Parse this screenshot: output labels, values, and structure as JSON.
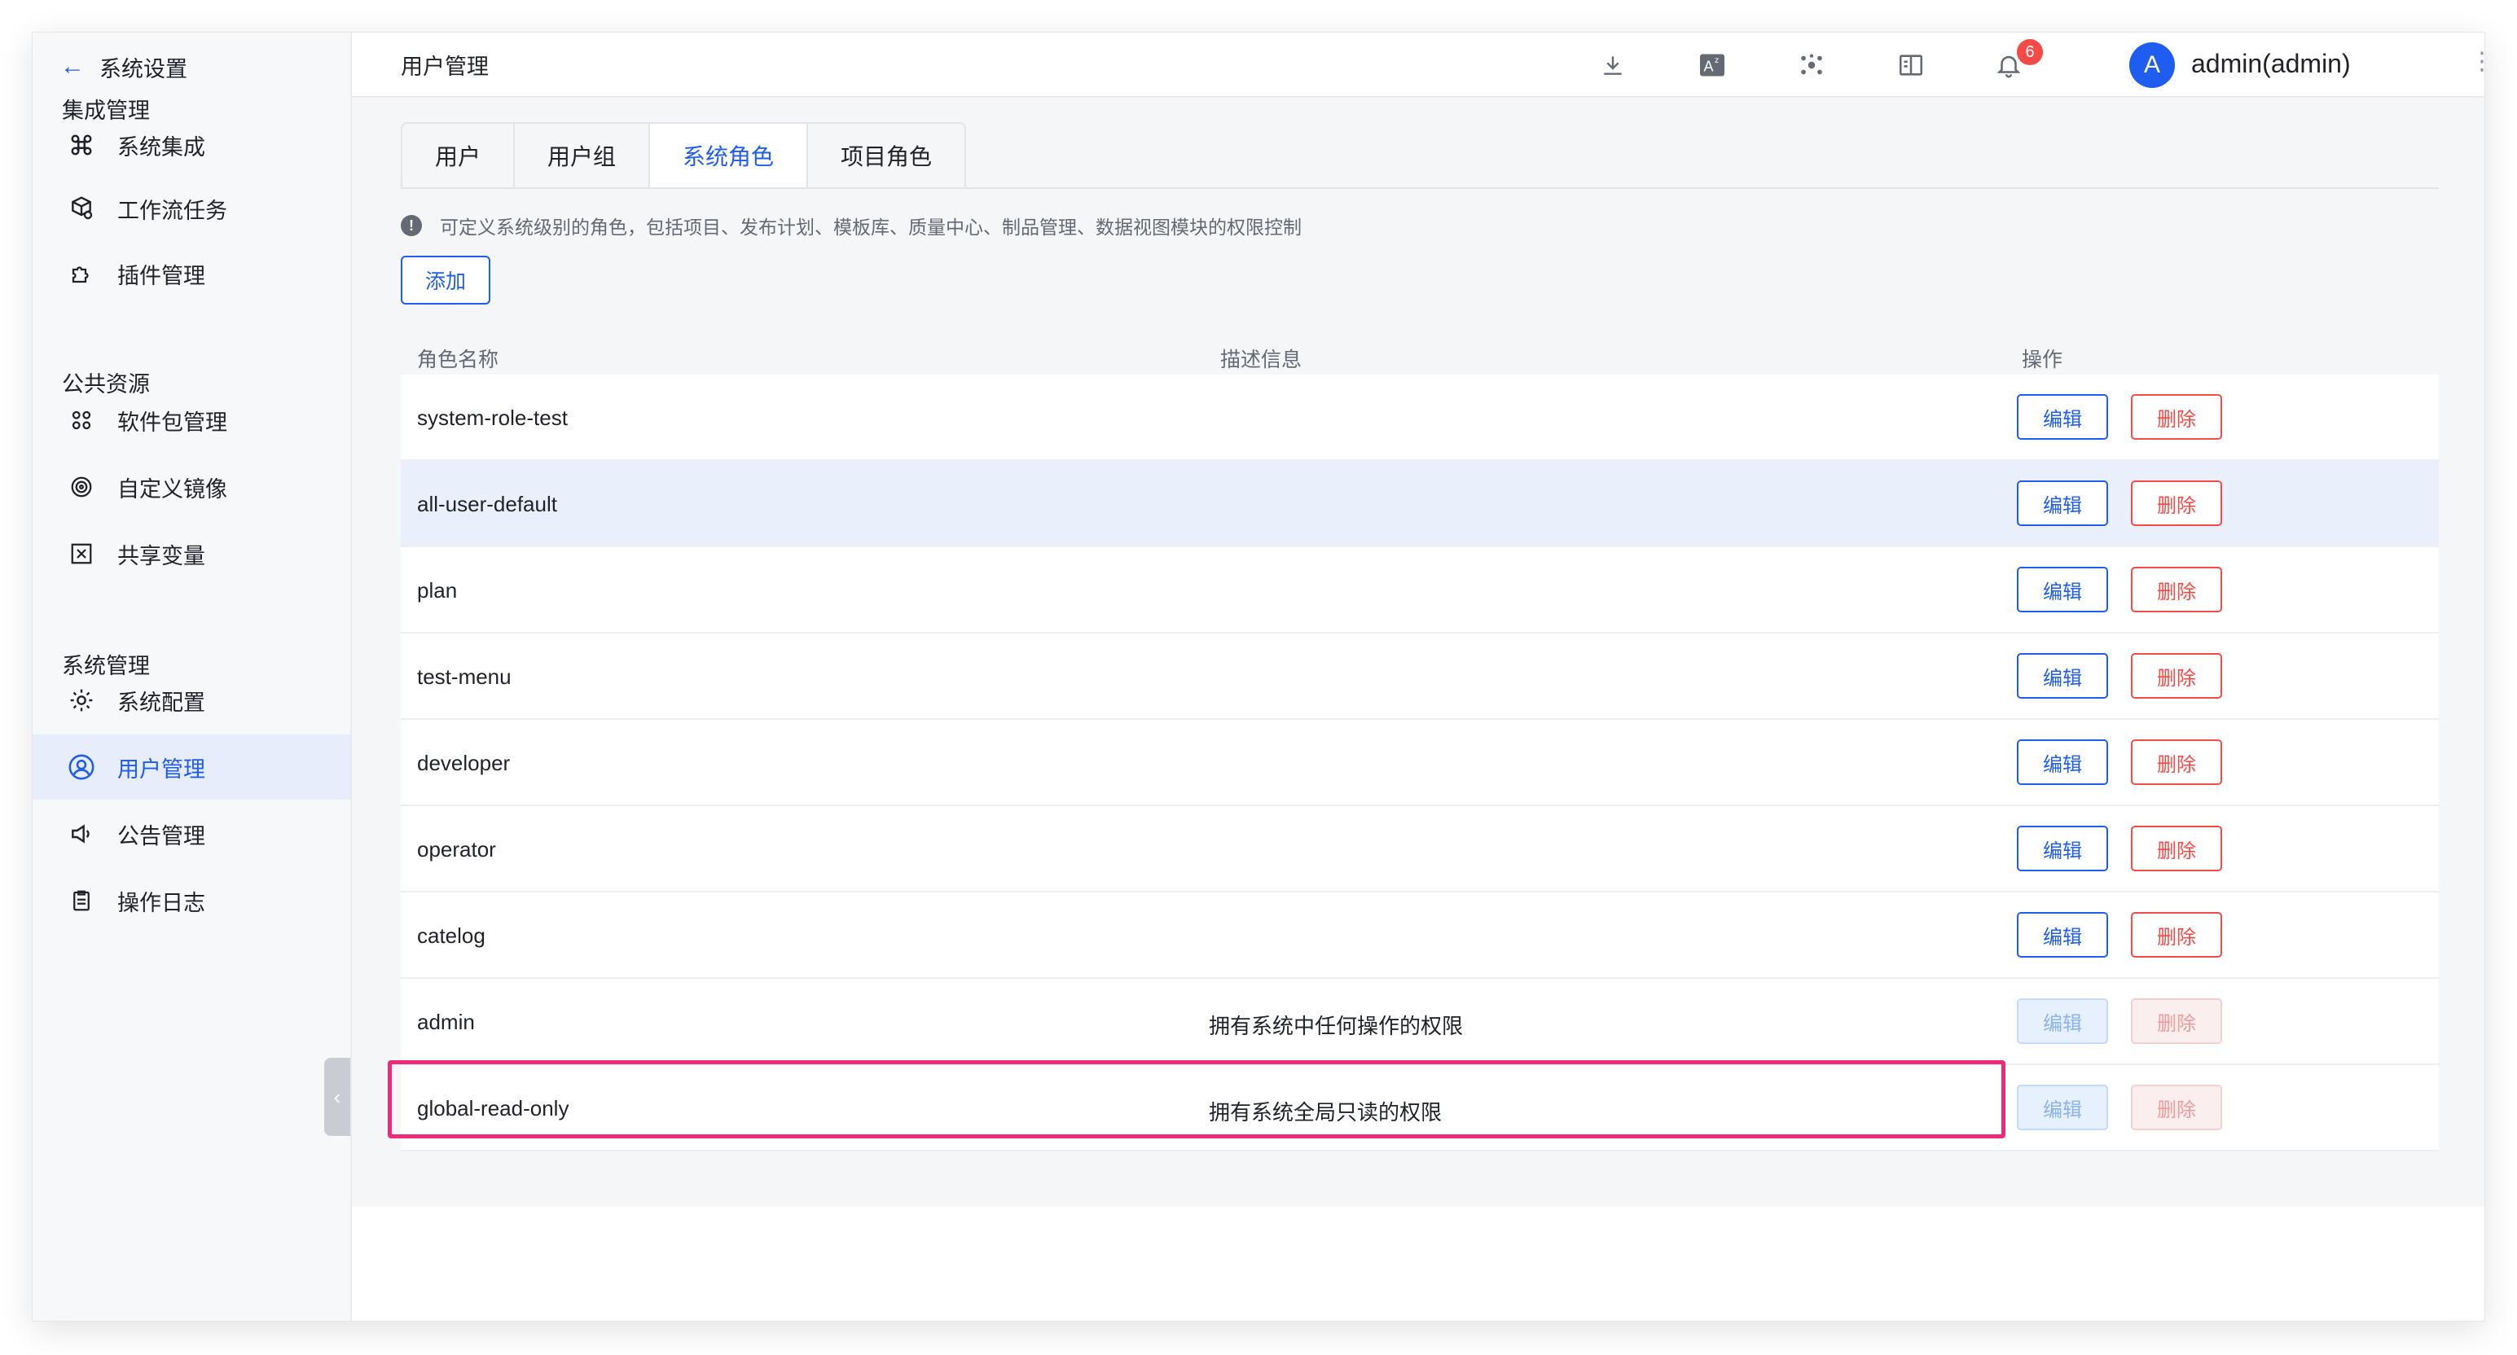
{
  "sidebar": {
    "header": "系统设置",
    "groups": [
      {
        "title": "集成管理",
        "items": [
          {
            "label": "系统集成",
            "icon": "command-icon"
          },
          {
            "label": "工作流任务",
            "icon": "cube-gear-icon"
          },
          {
            "label": "插件管理",
            "icon": "puzzle-icon"
          }
        ]
      },
      {
        "title": "公共资源",
        "items": [
          {
            "label": "软件包管理",
            "icon": "grid-icon"
          },
          {
            "label": "自定义镜像",
            "icon": "disc-icon"
          },
          {
            "label": "共享变量",
            "icon": "variable-icon"
          }
        ]
      },
      {
        "title": "系统管理",
        "items": [
          {
            "label": "系统配置",
            "icon": "gear-icon"
          },
          {
            "label": "用户管理",
            "icon": "user-icon"
          },
          {
            "label": "公告管理",
            "icon": "speaker-icon"
          },
          {
            "label": "操作日志",
            "icon": "clipboard-icon"
          }
        ]
      }
    ],
    "active_item": "用户管理"
  },
  "topbar": {
    "title": "用户管理",
    "notification_count": "6",
    "avatar_letter": "A",
    "username": "admin(admin)"
  },
  "tabs": [
    "用户",
    "用户组",
    "系统角色",
    "项目角色"
  ],
  "active_tab": "系统角色",
  "info_text": "可定义系统级别的角色，包括项目、发布计划、模板库、质量中心、制品管理、数据视图模块的权限控制",
  "add_label": "添加",
  "table": {
    "columns": [
      "角色名称",
      "描述信息",
      "操作"
    ],
    "edit_label": "编辑",
    "delete_label": "删除",
    "rows": [
      {
        "name": "system-role-test",
        "desc": "",
        "disabled": false
      },
      {
        "name": "all-user-default",
        "desc": "",
        "disabled": false
      },
      {
        "name": "plan",
        "desc": "",
        "disabled": false
      },
      {
        "name": "test-menu",
        "desc": "",
        "disabled": false
      },
      {
        "name": "developer",
        "desc": "",
        "disabled": false
      },
      {
        "name": "operator",
        "desc": "",
        "disabled": false
      },
      {
        "name": "catelog",
        "desc": "",
        "disabled": false
      },
      {
        "name": "admin",
        "desc": "拥有系统中任何操作的权限",
        "disabled": true
      },
      {
        "name": "global-read-only",
        "desc": "拥有系统全局只读的权限",
        "disabled": true
      }
    ]
  },
  "colors": {
    "accent": "#1f5cf0",
    "danger": "#f54a45",
    "highlight": "#ee2a7b"
  }
}
